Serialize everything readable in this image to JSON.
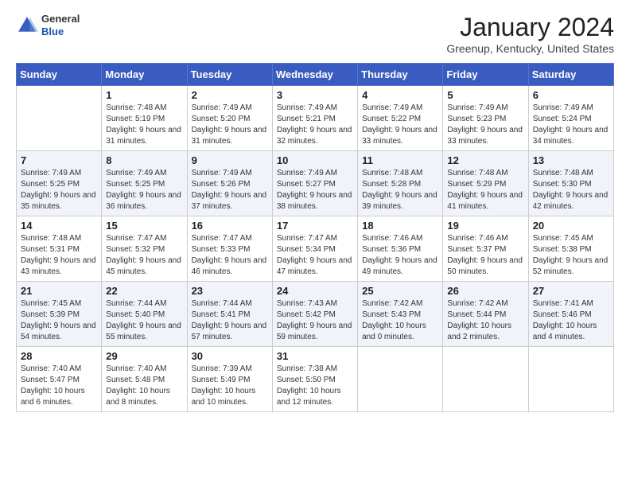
{
  "header": {
    "logo": {
      "general": "General",
      "blue": "Blue"
    },
    "title": "January 2024",
    "subtitle": "Greenup, Kentucky, United States"
  },
  "weekdays": [
    "Sunday",
    "Monday",
    "Tuesday",
    "Wednesday",
    "Thursday",
    "Friday",
    "Saturday"
  ],
  "weeks": [
    [
      {
        "day": "",
        "sunrise": "",
        "sunset": "",
        "daylight": ""
      },
      {
        "day": "1",
        "sunrise": "Sunrise: 7:48 AM",
        "sunset": "Sunset: 5:19 PM",
        "daylight": "Daylight: 9 hours and 31 minutes."
      },
      {
        "day": "2",
        "sunrise": "Sunrise: 7:49 AM",
        "sunset": "Sunset: 5:20 PM",
        "daylight": "Daylight: 9 hours and 31 minutes."
      },
      {
        "day": "3",
        "sunrise": "Sunrise: 7:49 AM",
        "sunset": "Sunset: 5:21 PM",
        "daylight": "Daylight: 9 hours and 32 minutes."
      },
      {
        "day": "4",
        "sunrise": "Sunrise: 7:49 AM",
        "sunset": "Sunset: 5:22 PM",
        "daylight": "Daylight: 9 hours and 33 minutes."
      },
      {
        "day": "5",
        "sunrise": "Sunrise: 7:49 AM",
        "sunset": "Sunset: 5:23 PM",
        "daylight": "Daylight: 9 hours and 33 minutes."
      },
      {
        "day": "6",
        "sunrise": "Sunrise: 7:49 AM",
        "sunset": "Sunset: 5:24 PM",
        "daylight": "Daylight: 9 hours and 34 minutes."
      }
    ],
    [
      {
        "day": "7",
        "sunrise": "Sunrise: 7:49 AM",
        "sunset": "Sunset: 5:25 PM",
        "daylight": "Daylight: 9 hours and 35 minutes."
      },
      {
        "day": "8",
        "sunrise": "Sunrise: 7:49 AM",
        "sunset": "Sunset: 5:25 PM",
        "daylight": "Daylight: 9 hours and 36 minutes."
      },
      {
        "day": "9",
        "sunrise": "Sunrise: 7:49 AM",
        "sunset": "Sunset: 5:26 PM",
        "daylight": "Daylight: 9 hours and 37 minutes."
      },
      {
        "day": "10",
        "sunrise": "Sunrise: 7:49 AM",
        "sunset": "Sunset: 5:27 PM",
        "daylight": "Daylight: 9 hours and 38 minutes."
      },
      {
        "day": "11",
        "sunrise": "Sunrise: 7:48 AM",
        "sunset": "Sunset: 5:28 PM",
        "daylight": "Daylight: 9 hours and 39 minutes."
      },
      {
        "day": "12",
        "sunrise": "Sunrise: 7:48 AM",
        "sunset": "Sunset: 5:29 PM",
        "daylight": "Daylight: 9 hours and 41 minutes."
      },
      {
        "day": "13",
        "sunrise": "Sunrise: 7:48 AM",
        "sunset": "Sunset: 5:30 PM",
        "daylight": "Daylight: 9 hours and 42 minutes."
      }
    ],
    [
      {
        "day": "14",
        "sunrise": "Sunrise: 7:48 AM",
        "sunset": "Sunset: 5:31 PM",
        "daylight": "Daylight: 9 hours and 43 minutes."
      },
      {
        "day": "15",
        "sunrise": "Sunrise: 7:47 AM",
        "sunset": "Sunset: 5:32 PM",
        "daylight": "Daylight: 9 hours and 45 minutes."
      },
      {
        "day": "16",
        "sunrise": "Sunrise: 7:47 AM",
        "sunset": "Sunset: 5:33 PM",
        "daylight": "Daylight: 9 hours and 46 minutes."
      },
      {
        "day": "17",
        "sunrise": "Sunrise: 7:47 AM",
        "sunset": "Sunset: 5:34 PM",
        "daylight": "Daylight: 9 hours and 47 minutes."
      },
      {
        "day": "18",
        "sunrise": "Sunrise: 7:46 AM",
        "sunset": "Sunset: 5:36 PM",
        "daylight": "Daylight: 9 hours and 49 minutes."
      },
      {
        "day": "19",
        "sunrise": "Sunrise: 7:46 AM",
        "sunset": "Sunset: 5:37 PM",
        "daylight": "Daylight: 9 hours and 50 minutes."
      },
      {
        "day": "20",
        "sunrise": "Sunrise: 7:45 AM",
        "sunset": "Sunset: 5:38 PM",
        "daylight": "Daylight: 9 hours and 52 minutes."
      }
    ],
    [
      {
        "day": "21",
        "sunrise": "Sunrise: 7:45 AM",
        "sunset": "Sunset: 5:39 PM",
        "daylight": "Daylight: 9 hours and 54 minutes."
      },
      {
        "day": "22",
        "sunrise": "Sunrise: 7:44 AM",
        "sunset": "Sunset: 5:40 PM",
        "daylight": "Daylight: 9 hours and 55 minutes."
      },
      {
        "day": "23",
        "sunrise": "Sunrise: 7:44 AM",
        "sunset": "Sunset: 5:41 PM",
        "daylight": "Daylight: 9 hours and 57 minutes."
      },
      {
        "day": "24",
        "sunrise": "Sunrise: 7:43 AM",
        "sunset": "Sunset: 5:42 PM",
        "daylight": "Daylight: 9 hours and 59 minutes."
      },
      {
        "day": "25",
        "sunrise": "Sunrise: 7:42 AM",
        "sunset": "Sunset: 5:43 PM",
        "daylight": "Daylight: 10 hours and 0 minutes."
      },
      {
        "day": "26",
        "sunrise": "Sunrise: 7:42 AM",
        "sunset": "Sunset: 5:44 PM",
        "daylight": "Daylight: 10 hours and 2 minutes."
      },
      {
        "day": "27",
        "sunrise": "Sunrise: 7:41 AM",
        "sunset": "Sunset: 5:46 PM",
        "daylight": "Daylight: 10 hours and 4 minutes."
      }
    ],
    [
      {
        "day": "28",
        "sunrise": "Sunrise: 7:40 AM",
        "sunset": "Sunset: 5:47 PM",
        "daylight": "Daylight: 10 hours and 6 minutes."
      },
      {
        "day": "29",
        "sunrise": "Sunrise: 7:40 AM",
        "sunset": "Sunset: 5:48 PM",
        "daylight": "Daylight: 10 hours and 8 minutes."
      },
      {
        "day": "30",
        "sunrise": "Sunrise: 7:39 AM",
        "sunset": "Sunset: 5:49 PM",
        "daylight": "Daylight: 10 hours and 10 minutes."
      },
      {
        "day": "31",
        "sunrise": "Sunrise: 7:38 AM",
        "sunset": "Sunset: 5:50 PM",
        "daylight": "Daylight: 10 hours and 12 minutes."
      },
      {
        "day": "",
        "sunrise": "",
        "sunset": "",
        "daylight": ""
      },
      {
        "day": "",
        "sunrise": "",
        "sunset": "",
        "daylight": ""
      },
      {
        "day": "",
        "sunrise": "",
        "sunset": "",
        "daylight": ""
      }
    ]
  ]
}
